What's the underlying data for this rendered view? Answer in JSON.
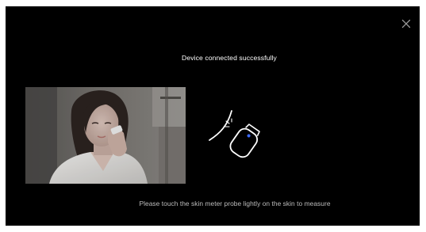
{
  "dialog": {
    "title": "Device connected successfully",
    "instruction": "Please touch the skin meter probe lightly on the skin to measure",
    "close_icon": "close-icon",
    "illustration_icon": "skin-meter-probe-icon"
  },
  "colors": {
    "background": "#000000",
    "title_text": "#ffffff",
    "instruction_text": "#bdbdbd",
    "close_icon": "#9a9a9a",
    "probe_stroke": "#ffffff",
    "probe_indicator": "#3c6bff"
  }
}
